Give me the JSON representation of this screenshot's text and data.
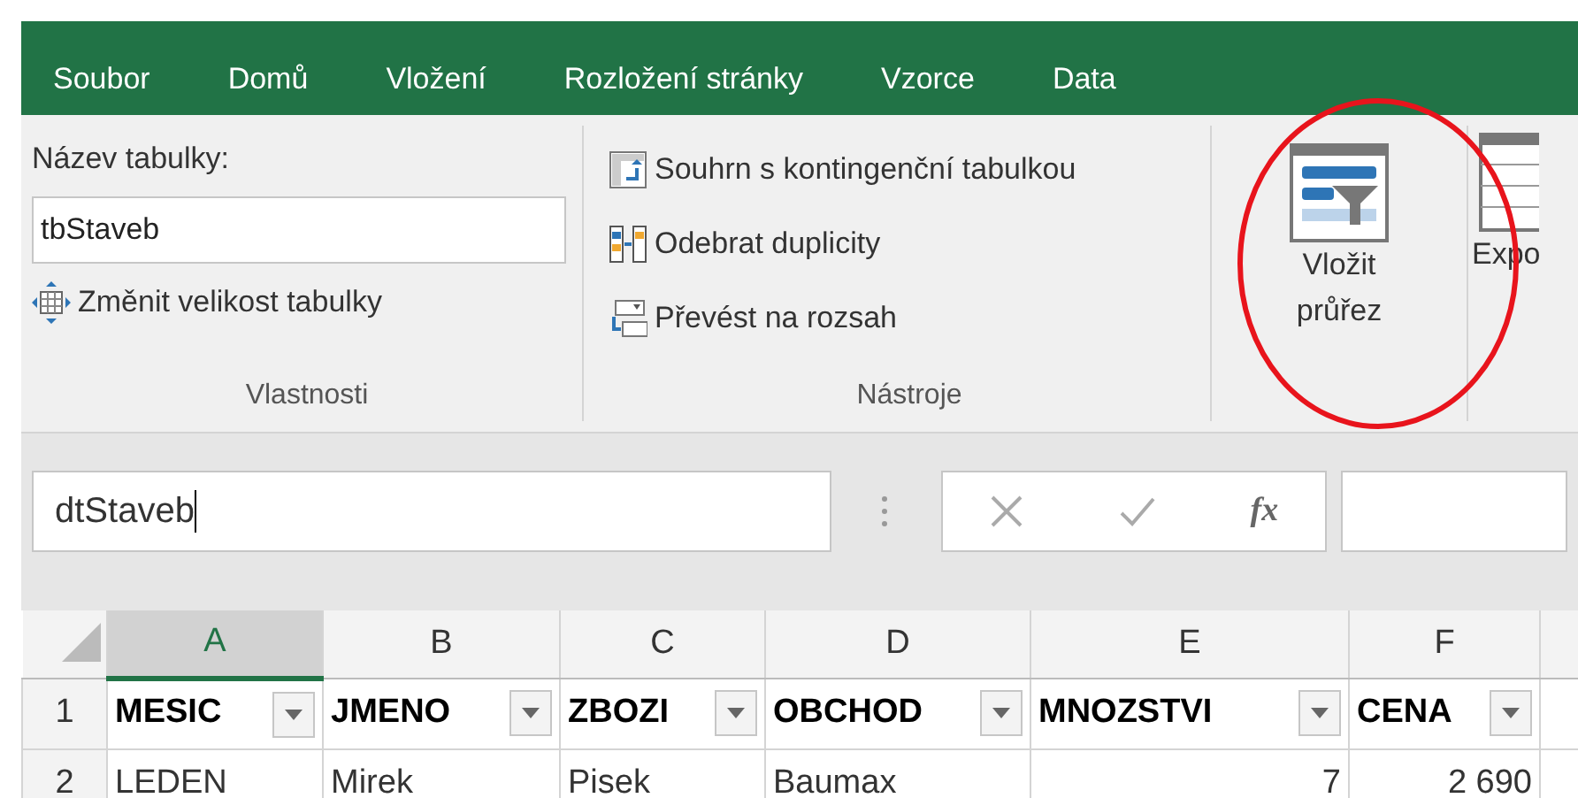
{
  "tabs": [
    {
      "label": "Soubor"
    },
    {
      "label": "Domů"
    },
    {
      "label": "Vložení"
    },
    {
      "label": "Rozložení stránky"
    },
    {
      "label": "Vzorce"
    },
    {
      "label": "Data"
    }
  ],
  "ribbon": {
    "properties": {
      "label": "Název tabulky:",
      "table_name": "tbStaveb",
      "resize": "Změnit velikost tabulky",
      "group_label": "Vlastnosti"
    },
    "tools": {
      "items": [
        {
          "kind": "pivot",
          "label": "Souhrn s kontingenční tabulkou"
        },
        {
          "kind": "duplicates",
          "label": "Odebrat duplicity"
        },
        {
          "kind": "convert",
          "label": "Převést na rozsah"
        }
      ],
      "group_label": "Nástroje"
    },
    "slicer": {
      "label": "Vložit průřez",
      "highlighted": true
    },
    "export": {
      "label": "Expo"
    }
  },
  "formula_bar": {
    "name_box": "dtStaveb",
    "function_button": "fx"
  },
  "grid": {
    "columns": [
      {
        "label": "A",
        "selected": true
      },
      {
        "label": "B",
        "selected": false
      },
      {
        "label": "C",
        "selected": false
      },
      {
        "label": "D",
        "selected": false
      },
      {
        "label": "E",
        "selected": false
      },
      {
        "label": "F",
        "selected": false
      }
    ],
    "rows": [
      {
        "number": "1",
        "kind": "header",
        "cells": [
          "MESIC",
          "JMENO",
          "ZBOZI",
          "OBCHOD",
          "MNOZSTVI",
          "CENA"
        ]
      },
      {
        "number": "2",
        "kind": "data",
        "cells": [
          "LEDEN",
          "Mirek",
          "Pisek",
          "Baumax",
          "7",
          "2 690"
        ]
      }
    ]
  }
}
